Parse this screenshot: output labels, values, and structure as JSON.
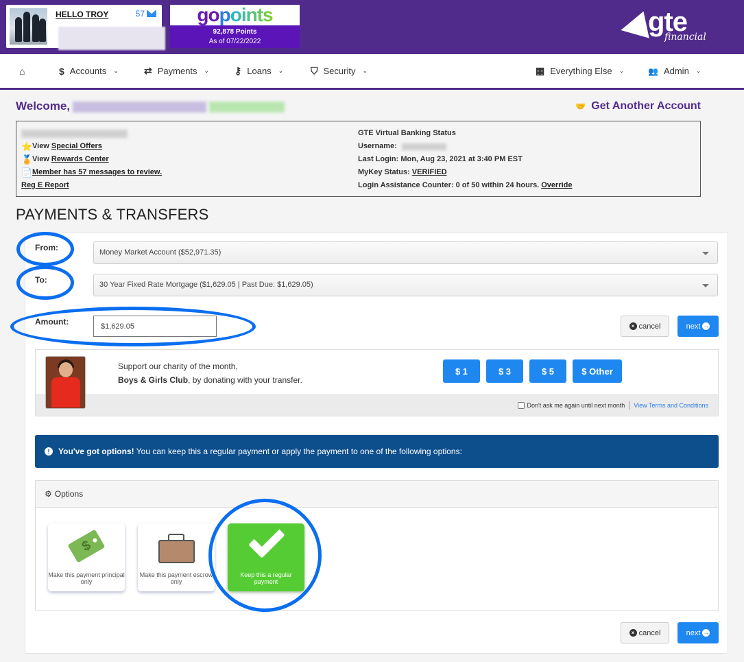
{
  "header": {
    "greeting": "HELLO TROY",
    "message_count": "57",
    "gopoints": {
      "logo_go": "go",
      "logo_p": "p",
      "logo_oints": "oints",
      "points": "92,878 Points",
      "as_of": "As of 07/22/2022"
    },
    "brand": {
      "name": "gte",
      "sub": "financial",
      "color": "#512b8c"
    }
  },
  "nav": {
    "items": [
      {
        "icon": "home-icon",
        "glyph": "⌂",
        "label": ""
      },
      {
        "icon": "dollar-icon",
        "glyph": "$",
        "label": "Accounts"
      },
      {
        "icon": "transfer-arrows-icon",
        "glyph": "⇄",
        "label": "Payments"
      },
      {
        "icon": "key-icon",
        "glyph": "⚷",
        "label": "Loans"
      },
      {
        "icon": "shield-icon",
        "glyph": "⛉",
        "label": "Security"
      },
      {
        "icon": "grid-icon",
        "glyph": "▦",
        "label": "Everything Else"
      },
      {
        "icon": "users-icon",
        "glyph": "👥",
        "label": "Admin"
      }
    ]
  },
  "welcome": {
    "label": "Welcome,",
    "get_another_account": "Get Another Account"
  },
  "info": {
    "left": {
      "special_offers_prefix": "View ",
      "special_offers": "Special Offers",
      "rewards_prefix": "View ",
      "rewards": "Rewards Center",
      "messages": "Member has 57 messages to review.",
      "reg_e": "Reg E Report"
    },
    "right": {
      "title": "GTE Virtual Banking Status",
      "username_label": "Username:",
      "last_login": "Last Login: Mon, Aug 23, 2021 at 3:40 PM EST",
      "mykey_label": "MyKey Status: ",
      "mykey_value": "VERIFIED",
      "login_counter": "Login Assistance Counter: 0 of 50 within 24 hours. ",
      "override": "Override"
    }
  },
  "payments": {
    "title": "PAYMENTS & TRANSFERS",
    "from_label": "From:",
    "from_value": "Money Market Account ($52,971.35)",
    "to_label": "To:",
    "to_value": "30 Year Fixed Rate Mortgage ($1,629.05 | Past Due: $1,629.05)",
    "amount_label": "Amount:",
    "amount_value": "$1,629.05",
    "cancel": "cancel",
    "next": "next"
  },
  "charity": {
    "line1": "Support our charity of the month,",
    "org": "Boys & Girls Club",
    "line2": ", by donating with your transfer.",
    "buttons": [
      "$ 1",
      "$ 3",
      "$ 5",
      "$ Other"
    ],
    "dont_ask": "Don't ask me again until next month",
    "terms": "View Terms and Conditions"
  },
  "alert": {
    "bold": "You've got options!",
    "text": " You can keep this a regular payment or apply the payment to one of the following options:"
  },
  "options": {
    "title": "Options",
    "cards": [
      {
        "label": "Make this payment principal only",
        "icon": "money-tag-icon",
        "selected": false
      },
      {
        "label": "Make this payment escrow only",
        "icon": "briefcase-icon",
        "selected": false
      },
      {
        "label": "Keep this a regular payment",
        "icon": "checkmark-icon",
        "selected": true
      }
    ]
  },
  "colors": {
    "brand_purple": "#512b8c",
    "primary_blue": "#1e88f0",
    "alert_navy": "#0d4e8c",
    "selected_green": "#55cc33",
    "annotation_blue": "#0a6ef0"
  }
}
